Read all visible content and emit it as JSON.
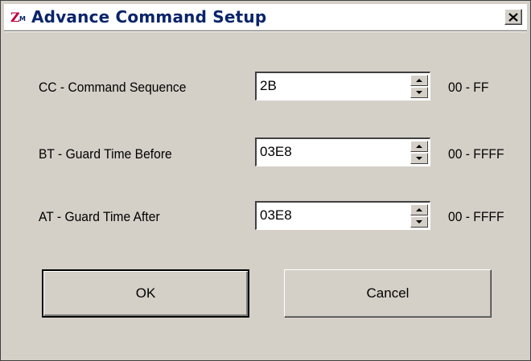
{
  "window": {
    "title": "Advance Command Setup",
    "app_icon": "zbee-app-icon",
    "close_icon": "close-icon"
  },
  "fields": [
    {
      "label": "CC - Command Sequence",
      "value": "2B",
      "range": "00 - FF"
    },
    {
      "label": "BT - Guard Time Before",
      "value": "03E8",
      "range": "00 - FFFF"
    },
    {
      "label": "AT - Guard Time After",
      "value": "03E8",
      "range": "00 - FFFF"
    }
  ],
  "buttons": {
    "ok": "OK",
    "cancel": "Cancel"
  },
  "colors": {
    "face": "#d4d0c8",
    "title_text": "#0a246a",
    "logo_red": "#c0003c",
    "logo_blue": "#0a246a"
  }
}
